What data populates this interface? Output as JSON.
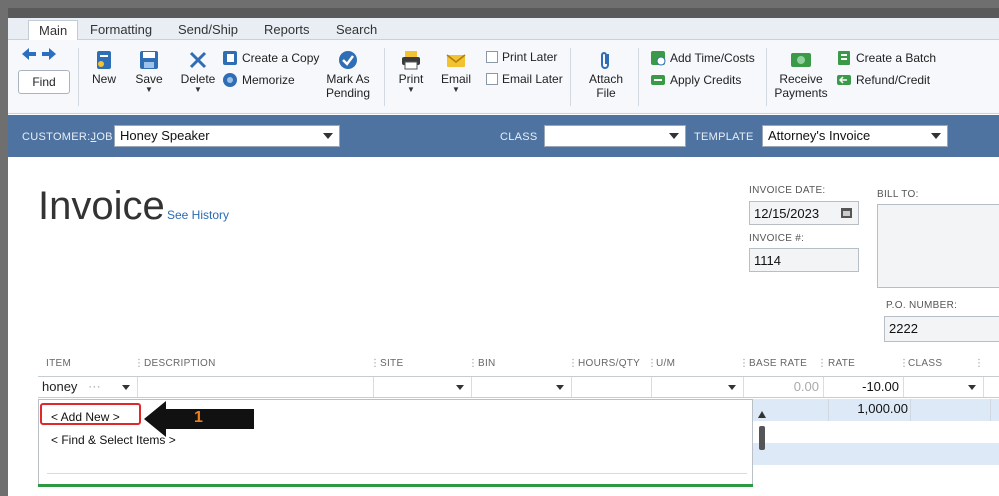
{
  "tabs": [
    {
      "label": "Main",
      "active": true
    },
    {
      "label": "Formatting"
    },
    {
      "label": "Send/Ship"
    },
    {
      "label": "Reports"
    },
    {
      "label": "Search"
    }
  ],
  "ribbon": {
    "find": "Find",
    "new": "New",
    "save": "Save",
    "delete": "Delete",
    "create_copy": "Create a Copy",
    "memorize": "Memorize",
    "mark_pending_1": "Mark As",
    "mark_pending_2": "Pending",
    "print": "Print",
    "email": "Email",
    "print_later": "Print Later",
    "email_later": "Email Later",
    "attach_1": "Attach",
    "attach_2": "File",
    "add_time_costs": "Add Time/Costs",
    "apply_credits": "Apply Credits",
    "receive_1": "Receive",
    "receive_2": "Payments",
    "create_batch": "Create a Batch",
    "refund_credit": "Refund/Credit"
  },
  "header_bar": {
    "customer_label_pre": "CUSTOMER:",
    "customer_label_j": "J",
    "customer_label_post": "OB",
    "customer_value": "Honey Speaker",
    "class_label": "CLASS",
    "class_value": "",
    "template_label": "TEMPLATE",
    "template_value": "Attorney's Invoice"
  },
  "invoice": {
    "title": "Invoice",
    "see_history": "See History",
    "date_label": "INVOICE DATE:",
    "date_value": "12/15/2023",
    "number_label": "INVOICE #:",
    "number_value": "1114",
    "bill_to_label": "BILL TO:",
    "po_label": "P.O. NUMBER:",
    "po_value": "2222"
  },
  "columns": [
    "ITEM",
    "DESCRIPTION",
    "SITE",
    "BIN",
    "HOURS/QTY",
    "U/M",
    "BASE RATE",
    "RATE",
    "CLASS"
  ],
  "item_row": {
    "item": "honey",
    "base_rate": "0.00",
    "rate": "-10.00"
  },
  "second_row": {
    "rate": "1,000.00"
  },
  "dropdown": {
    "add_new": "< Add New >",
    "find_select": "< Find & Select Items >"
  },
  "callout": {
    "number": "1"
  },
  "colors": {
    "blue_bar": "#4f73a0",
    "highlight_red": "#e0272a",
    "callout_orange": "#f07d1a",
    "row_blue": "#dde9f7"
  }
}
